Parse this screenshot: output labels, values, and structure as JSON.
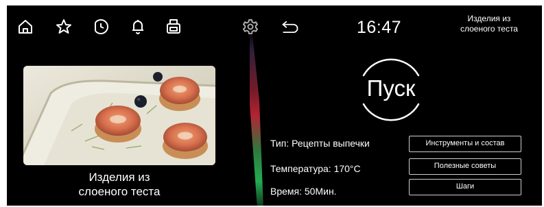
{
  "header": {
    "icons": [
      "home-icon",
      "star-icon",
      "clock-icon",
      "bell-icon",
      "printer-icon",
      "gear-icon",
      "back-icon"
    ],
    "time": "16:47",
    "title_line1": "Изделия из",
    "title_line2": "слоеного теста"
  },
  "recipe": {
    "image": "pastry-photo",
    "caption_line1": "Изделия из",
    "caption_line2": "слоеного теста"
  },
  "start_button": {
    "label": "Пуск"
  },
  "details": {
    "type": "Тип: Рецепты выпечки",
    "temperature": "Температура: 170°C",
    "time": "Время: 50Мин."
  },
  "buttons": {
    "tools": "Инструменты и состав",
    "tips": "Полезные советы",
    "steps": "Шаги"
  },
  "colors": {
    "background": "#000000",
    "text": "#ffffff",
    "divider_red": "#d2283c",
    "divider_green": "#28be5a"
  }
}
